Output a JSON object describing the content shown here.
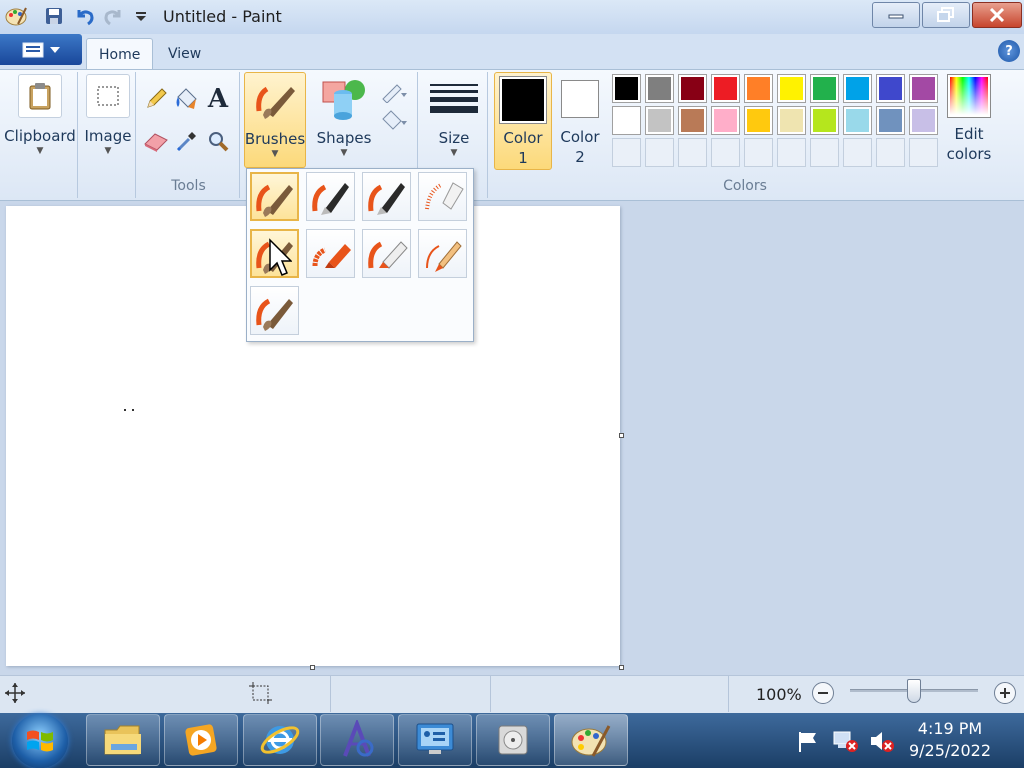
{
  "window": {
    "title": "Untitled - Paint"
  },
  "ribbon": {
    "tabs": [
      {
        "label": "Home"
      },
      {
        "label": "View"
      }
    ],
    "help_label": "?",
    "clipboard_label": "Clipboard",
    "image_label": "Image",
    "tools_group_label": "Tools",
    "brushes_label": "Brushes",
    "shapes_label": "Shapes",
    "size_label": "Size",
    "color1_label": "Color",
    "color1_num": "1",
    "color2_label": "Color",
    "color2_num": "2",
    "colors_group_label": "Colors",
    "edit_colors_label": "Edit",
    "edit_colors_label2": "colors",
    "color1_value": "#000000",
    "color2_value": "#ffffff",
    "palette_row1": [
      "#000000",
      "#7f7f7f",
      "#880015",
      "#ed1c24",
      "#ff7f27",
      "#fff200",
      "#22b14c",
      "#00a2e8",
      "#3f48cc",
      "#a349a4"
    ],
    "palette_row2": [
      "#ffffff",
      "#c3c3c3",
      "#b97a57",
      "#ffaec9",
      "#ffc90e",
      "#efe4b0",
      "#b5e61d",
      "#99d9ea",
      "#7092be",
      "#c8bfe7"
    ]
  },
  "brush_menu": {
    "items": [
      {
        "icon": "brush-icon",
        "selected": true
      },
      {
        "icon": "calligraphy-brush-1-icon"
      },
      {
        "icon": "calligraphy-brush-2-icon"
      },
      {
        "icon": "airbrush-icon"
      },
      {
        "icon": "oil-brush-icon",
        "selected": true
      },
      {
        "icon": "crayon-icon"
      },
      {
        "icon": "marker-icon"
      },
      {
        "icon": "natural-pencil-icon"
      },
      {
        "icon": "watercolor-brush-icon"
      }
    ]
  },
  "statusbar": {
    "zoom": "100%",
    "zoom_level_percent": 100
  },
  "taskbar": {
    "time": "4:19 PM",
    "date": "9/25/2022"
  }
}
